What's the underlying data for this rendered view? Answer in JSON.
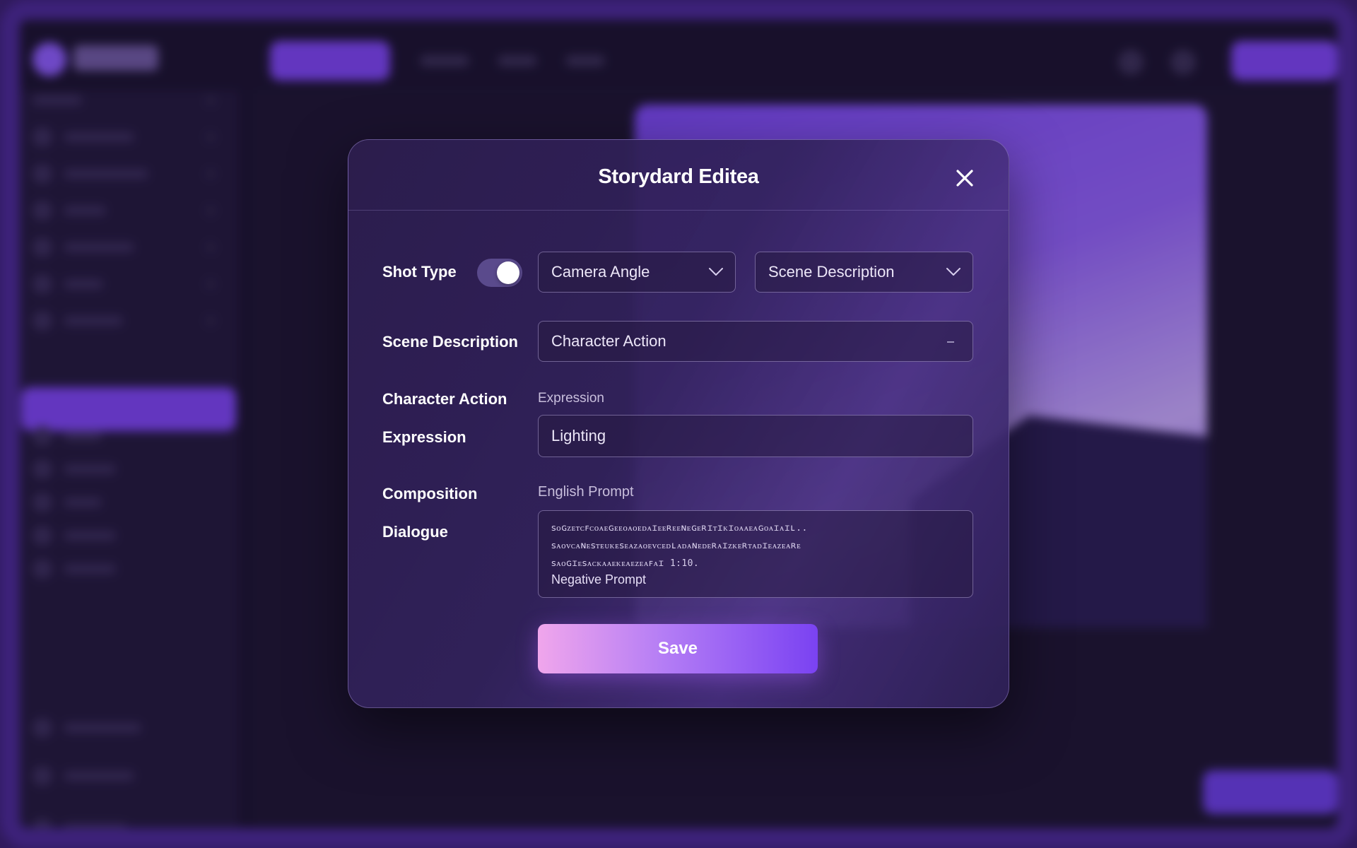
{
  "modal": {
    "title": "Storydard Editea",
    "close_icon": "close-icon",
    "shot_type_label": "Shot Type",
    "shot_type_enabled": true,
    "camera_angle": {
      "value": "Camera Angle",
      "icon": "chevron-down-icon"
    },
    "scene_select": {
      "value": "Scene Description",
      "icon": "chevron-down-icon"
    },
    "scene_description_label": "Scene Description",
    "scene_description_field": "Character Action",
    "character_action_label": "Character Action",
    "expression_hint": "Expression",
    "expression_label": "Expression",
    "expression_field": "Lighting",
    "composition_label": "Composition",
    "english_prompt_label": "English Prompt",
    "dialogue_label": "Dialogue",
    "prompt_lines": [
      "ꜱᴏɢᴢᴇᴛᴄꜰᴄᴏᴀᴇɢᴇᴇᴏᴀᴏᴇᴅᴀɪᴇᴇʀᴇᴇɴᴇɢᴇʀɪᴛɪᴋɪᴏᴀᴀᴇᴀɢᴏᴀɪᴀɪʟ..",
      "ꜱᴀᴏᴠᴄᴀɴᴇꜱᴛᴇᴜᴋᴇꜱᴇᴀᴢᴀᴏᴇᴠᴄᴇᴅʟᴀᴅᴀɴᴇᴅᴇʀᴀɪᴢᴋᴇʀᴛᴀᴅɪᴇᴀᴢᴇᴀʀᴇ",
      "ꜱᴀᴏɢɪᴇꜱᴀᴄᴋᴀᴀᴇᴋᴇᴀᴇᴢᴇᴀꜰᴀɪ 1:10."
    ],
    "negative_prompt_label": "Negative Prompt",
    "save_label": "Save"
  },
  "colors": {
    "accent": "#7b45ee",
    "save_gradient_start": "#f0a6ec",
    "save_gradient_end": "#7a42f2",
    "modal_bg": "#2c1e4e"
  }
}
